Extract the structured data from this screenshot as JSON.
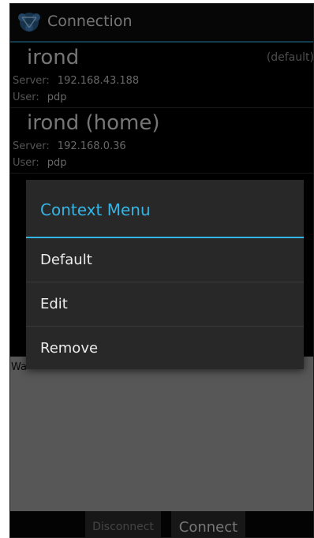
{
  "actionbar": {
    "title": "Connection",
    "icon": "network-app-icon"
  },
  "connections": [
    {
      "name": "irond",
      "badge": "(default)",
      "server_label": "Server:",
      "server": "192.168.43.188",
      "user_label": "User:",
      "user": "pdp"
    },
    {
      "name": "irond (home)",
      "badge": "",
      "server_label": "Server:",
      "server": "192.168.0.36",
      "user_label": "User:",
      "user": "pdp"
    }
  ],
  "log": {
    "text": "Wa"
  },
  "buttons": {
    "disconnect": "Disconnect",
    "connect": "Connect"
  },
  "context_menu": {
    "title": "Context Menu",
    "items": [
      "Default",
      "Edit",
      "Remove"
    ]
  },
  "colors": {
    "accent": "#33b5e5",
    "background": "#000000",
    "dialog": "#282828",
    "log_area": "#9e9e9e"
  }
}
